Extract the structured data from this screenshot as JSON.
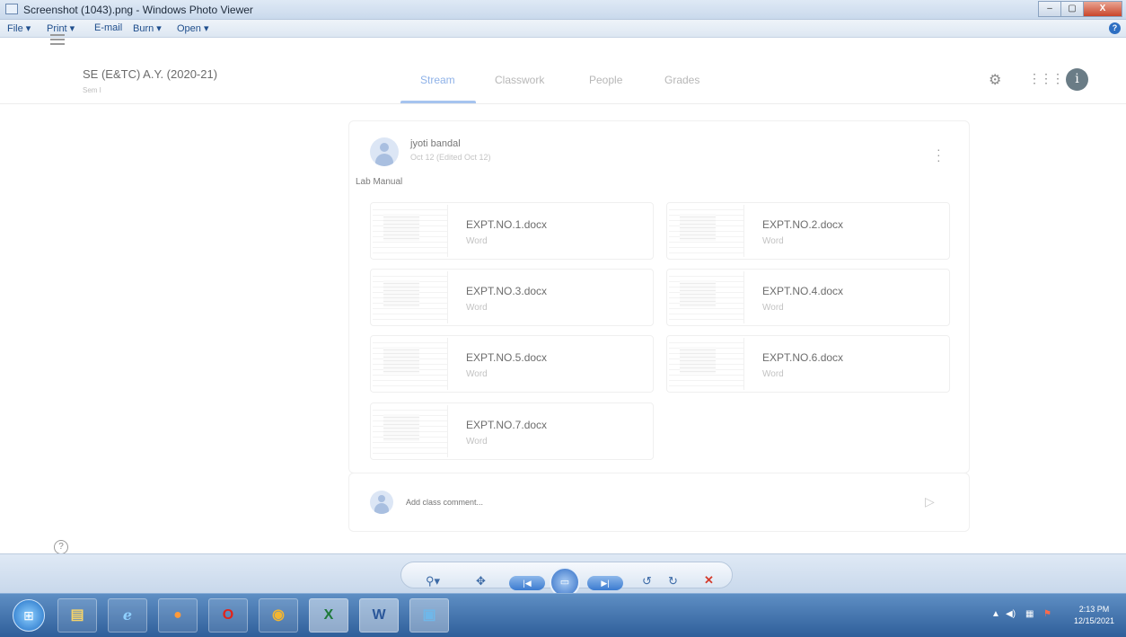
{
  "window": {
    "title": "Screenshot (1043).png - Windows Photo Viewer",
    "min_label": "–",
    "max_label": "▢",
    "close_label": "X"
  },
  "menubar": {
    "items": [
      "File ▾",
      "Print ▾",
      "E-mail",
      "Burn ▾",
      "Open ▾"
    ],
    "help": "?"
  },
  "classroom": {
    "class_title": "SE (E&TC) A.Y. (2020-21)",
    "class_subtitle": "Sem I",
    "tabs": [
      "Stream",
      "Classwork",
      "People",
      "Grades"
    ],
    "active_tab": "Stream",
    "avatar_letter": "i"
  },
  "post": {
    "author": "jyoti bandal",
    "date": "Oct 12 (Edited Oct 12)",
    "text": "Lab Manual",
    "attachments": [
      {
        "name": "EXPT.NO.1.docx",
        "type": "Word"
      },
      {
        "name": "EXPT.NO.2.docx",
        "type": "Word"
      },
      {
        "name": "EXPT.NO.3.docx",
        "type": "Word"
      },
      {
        "name": "EXPT.NO.4.docx",
        "type": "Word"
      },
      {
        "name": "EXPT.NO.5.docx",
        "type": "Word"
      },
      {
        "name": "EXPT.NO.6.docx",
        "type": "Word"
      },
      {
        "name": "EXPT.NO.7.docx",
        "type": "Word"
      }
    ]
  },
  "comment": {
    "placeholder": "Add class comment..."
  },
  "taskbar": {
    "apps": [
      "file-explorer",
      "internet-explorer",
      "media-player",
      "opera",
      "chrome",
      "excel",
      "word",
      "photo-viewer"
    ],
    "word_letter": "W",
    "excel_letter": "X",
    "time": "2:13 PM",
    "date": "12/15/2021"
  }
}
